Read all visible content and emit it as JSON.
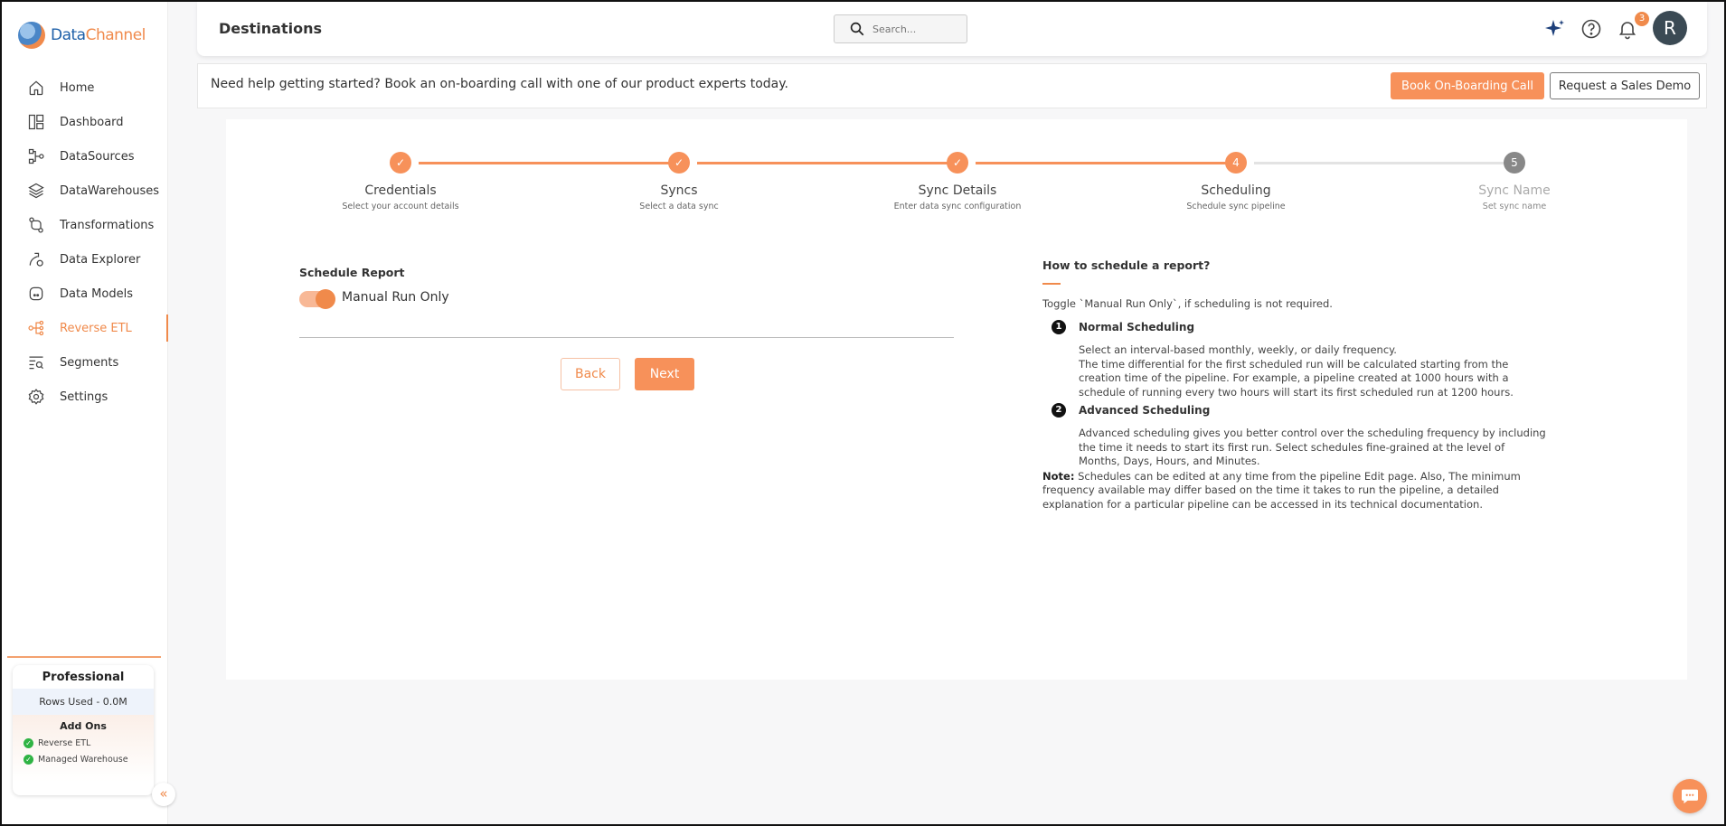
{
  "brand": {
    "part1": "Data",
    "part2": "Channel"
  },
  "colors": {
    "accent": "#f08a4b",
    "success": "#2fb344",
    "avatar": "#3b4a54"
  },
  "sidebar": {
    "items": [
      {
        "label": "Home",
        "icon": "home-icon"
      },
      {
        "label": "Dashboard",
        "icon": "dashboard-icon"
      },
      {
        "label": "DataSources",
        "icon": "datasources-icon"
      },
      {
        "label": "DataWarehouses",
        "icon": "layers-icon"
      },
      {
        "label": "Transformations",
        "icon": "transform-icon"
      },
      {
        "label": "Data Explorer",
        "icon": "explorer-icon"
      },
      {
        "label": "Data Models",
        "icon": "models-icon"
      },
      {
        "label": "Reverse ETL",
        "icon": "reverse-etl-icon",
        "active": true
      },
      {
        "label": "Segments",
        "icon": "segments-icon"
      },
      {
        "label": "Settings",
        "icon": "gear-icon"
      }
    ],
    "plan": {
      "title": "Professional",
      "rows_used": "Rows Used - 0.0M",
      "addons_title": "Add Ons",
      "addons": [
        "Reverse ETL",
        "Managed Warehouse"
      ]
    },
    "collapse_icon": "double-chevron-left-icon"
  },
  "header": {
    "title": "Destinations",
    "search_placeholder": "Search...",
    "notification_count": "3",
    "avatar_initial": "R"
  },
  "banner": {
    "text": "Need help getting started? Book an on-boarding call with one of our product experts today.",
    "book_button": "Book On-Boarding Call",
    "demo_button": "Request a Sales Demo"
  },
  "stepper": {
    "current": 4,
    "steps": [
      {
        "number": "1",
        "title": "Credentials",
        "subtitle": "Select your account details",
        "status": "done"
      },
      {
        "number": "2",
        "title": "Syncs",
        "subtitle": "Select a data sync",
        "status": "done"
      },
      {
        "number": "3",
        "title": "Sync Details",
        "subtitle": "Enter data sync configuration",
        "status": "done"
      },
      {
        "number": "4",
        "title": "Scheduling",
        "subtitle": "Schedule sync pipeline",
        "status": "current"
      },
      {
        "number": "5",
        "title": "Sync Name",
        "subtitle": "Set sync name",
        "status": "pending"
      }
    ]
  },
  "form": {
    "section_label": "Schedule Report",
    "toggle_label": "Manual Run Only",
    "toggle_on": true,
    "back_button": "Back",
    "next_button": "Next"
  },
  "help": {
    "title": "How to schedule a report?",
    "intro": "Toggle `Manual Run Only`, if scheduling is not required.",
    "items": [
      {
        "number": "1",
        "title": "Normal Scheduling",
        "body": "Select an interval-based monthly, weekly, or daily frequency.",
        "body2": "The time differential for the first scheduled run will be calculated starting from the creation time of the pipeline. For example, a pipeline created at 1000 hours with a schedule of running every two hours will start its first scheduled run at 1200 hours."
      },
      {
        "number": "2",
        "title": "Advanced Scheduling",
        "body": "Advanced scheduling gives you better control over the scheduling frequency by including the time it needs to start its first run. Select schedules fine-grained at the level of Months, Days, Hours, and Minutes."
      }
    ],
    "note_label": "Note:",
    "note_text": " Schedules can be edited at any time from the pipeline Edit page. Also, The minimum frequency available may differ based on the time it takes to run the pipeline, a detailed explanation for a particular pipeline can be accessed in its technical documentation."
  }
}
